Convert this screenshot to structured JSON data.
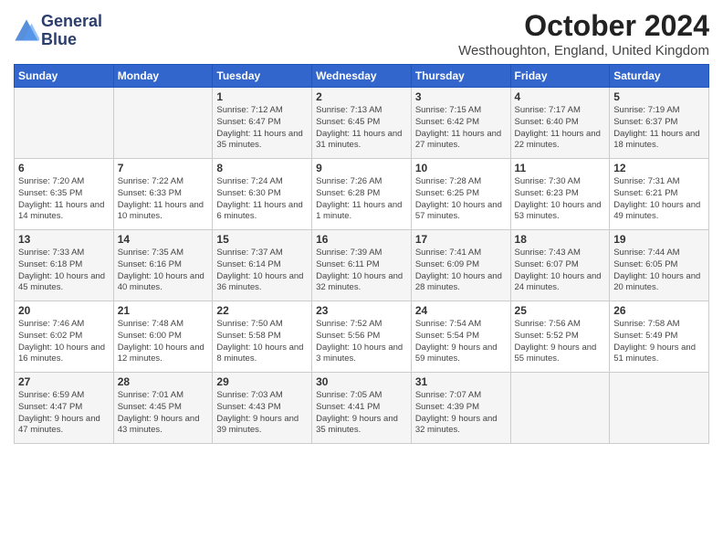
{
  "logo": {
    "line1": "General",
    "line2": "Blue"
  },
  "title": "October 2024",
  "subtitle": "Westhoughton, England, United Kingdom",
  "days_of_week": [
    "Sunday",
    "Monday",
    "Tuesday",
    "Wednesday",
    "Thursday",
    "Friday",
    "Saturday"
  ],
  "weeks": [
    [
      {
        "day": "",
        "content": ""
      },
      {
        "day": "",
        "content": ""
      },
      {
        "day": "1",
        "content": "Sunrise: 7:12 AM\nSunset: 6:47 PM\nDaylight: 11 hours\nand 35 minutes."
      },
      {
        "day": "2",
        "content": "Sunrise: 7:13 AM\nSunset: 6:45 PM\nDaylight: 11 hours\nand 31 minutes."
      },
      {
        "day": "3",
        "content": "Sunrise: 7:15 AM\nSunset: 6:42 PM\nDaylight: 11 hours\nand 27 minutes."
      },
      {
        "day": "4",
        "content": "Sunrise: 7:17 AM\nSunset: 6:40 PM\nDaylight: 11 hours\nand 22 minutes."
      },
      {
        "day": "5",
        "content": "Sunrise: 7:19 AM\nSunset: 6:37 PM\nDaylight: 11 hours\nand 18 minutes."
      }
    ],
    [
      {
        "day": "6",
        "content": "Sunrise: 7:20 AM\nSunset: 6:35 PM\nDaylight: 11 hours\nand 14 minutes."
      },
      {
        "day": "7",
        "content": "Sunrise: 7:22 AM\nSunset: 6:33 PM\nDaylight: 11 hours\nand 10 minutes."
      },
      {
        "day": "8",
        "content": "Sunrise: 7:24 AM\nSunset: 6:30 PM\nDaylight: 11 hours\nand 6 minutes."
      },
      {
        "day": "9",
        "content": "Sunrise: 7:26 AM\nSunset: 6:28 PM\nDaylight: 11 hours\nand 1 minute."
      },
      {
        "day": "10",
        "content": "Sunrise: 7:28 AM\nSunset: 6:25 PM\nDaylight: 10 hours\nand 57 minutes."
      },
      {
        "day": "11",
        "content": "Sunrise: 7:30 AM\nSunset: 6:23 PM\nDaylight: 10 hours\nand 53 minutes."
      },
      {
        "day": "12",
        "content": "Sunrise: 7:31 AM\nSunset: 6:21 PM\nDaylight: 10 hours\nand 49 minutes."
      }
    ],
    [
      {
        "day": "13",
        "content": "Sunrise: 7:33 AM\nSunset: 6:18 PM\nDaylight: 10 hours\nand 45 minutes."
      },
      {
        "day": "14",
        "content": "Sunrise: 7:35 AM\nSunset: 6:16 PM\nDaylight: 10 hours\nand 40 minutes."
      },
      {
        "day": "15",
        "content": "Sunrise: 7:37 AM\nSunset: 6:14 PM\nDaylight: 10 hours\nand 36 minutes."
      },
      {
        "day": "16",
        "content": "Sunrise: 7:39 AM\nSunset: 6:11 PM\nDaylight: 10 hours\nand 32 minutes."
      },
      {
        "day": "17",
        "content": "Sunrise: 7:41 AM\nSunset: 6:09 PM\nDaylight: 10 hours\nand 28 minutes."
      },
      {
        "day": "18",
        "content": "Sunrise: 7:43 AM\nSunset: 6:07 PM\nDaylight: 10 hours\nand 24 minutes."
      },
      {
        "day": "19",
        "content": "Sunrise: 7:44 AM\nSunset: 6:05 PM\nDaylight: 10 hours\nand 20 minutes."
      }
    ],
    [
      {
        "day": "20",
        "content": "Sunrise: 7:46 AM\nSunset: 6:02 PM\nDaylight: 10 hours\nand 16 minutes."
      },
      {
        "day": "21",
        "content": "Sunrise: 7:48 AM\nSunset: 6:00 PM\nDaylight: 10 hours\nand 12 minutes."
      },
      {
        "day": "22",
        "content": "Sunrise: 7:50 AM\nSunset: 5:58 PM\nDaylight: 10 hours\nand 8 minutes."
      },
      {
        "day": "23",
        "content": "Sunrise: 7:52 AM\nSunset: 5:56 PM\nDaylight: 10 hours\nand 3 minutes."
      },
      {
        "day": "24",
        "content": "Sunrise: 7:54 AM\nSunset: 5:54 PM\nDaylight: 9 hours\nand 59 minutes."
      },
      {
        "day": "25",
        "content": "Sunrise: 7:56 AM\nSunset: 5:52 PM\nDaylight: 9 hours\nand 55 minutes."
      },
      {
        "day": "26",
        "content": "Sunrise: 7:58 AM\nSunset: 5:49 PM\nDaylight: 9 hours\nand 51 minutes."
      }
    ],
    [
      {
        "day": "27",
        "content": "Sunrise: 6:59 AM\nSunset: 4:47 PM\nDaylight: 9 hours\nand 47 minutes."
      },
      {
        "day": "28",
        "content": "Sunrise: 7:01 AM\nSunset: 4:45 PM\nDaylight: 9 hours\nand 43 minutes."
      },
      {
        "day": "29",
        "content": "Sunrise: 7:03 AM\nSunset: 4:43 PM\nDaylight: 9 hours\nand 39 minutes."
      },
      {
        "day": "30",
        "content": "Sunrise: 7:05 AM\nSunset: 4:41 PM\nDaylight: 9 hours\nand 35 minutes."
      },
      {
        "day": "31",
        "content": "Sunrise: 7:07 AM\nSunset: 4:39 PM\nDaylight: 9 hours\nand 32 minutes."
      },
      {
        "day": "",
        "content": ""
      },
      {
        "day": "",
        "content": ""
      }
    ]
  ]
}
